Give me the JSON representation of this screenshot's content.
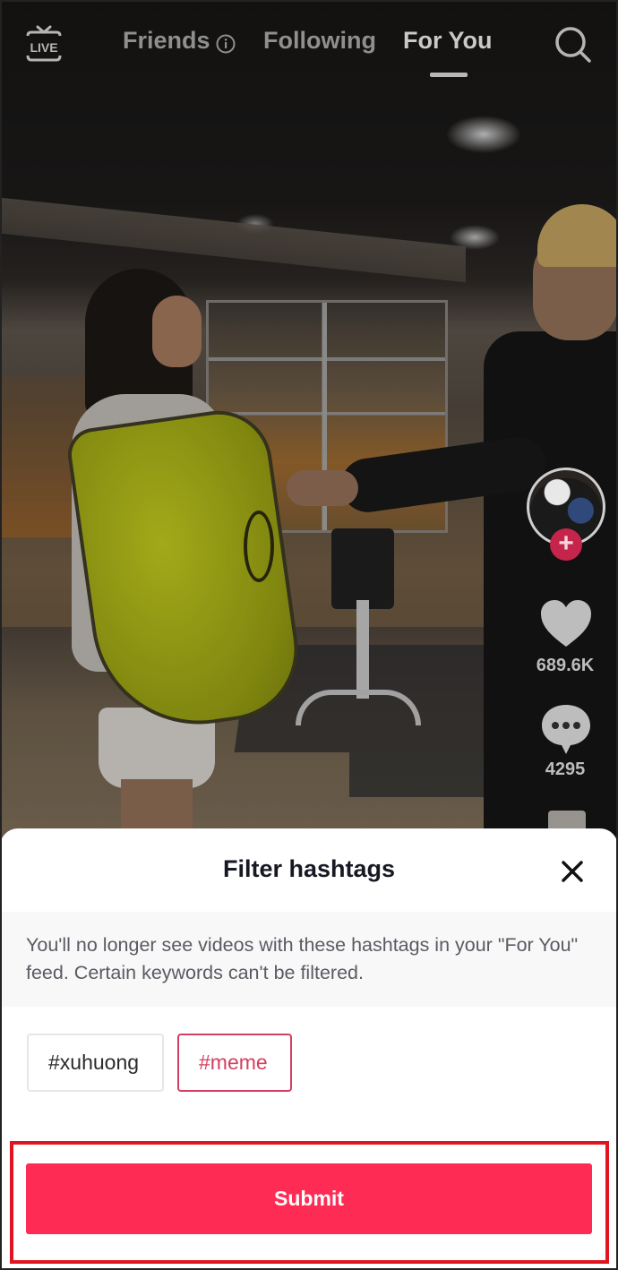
{
  "top_nav": {
    "live_label": "LIVE",
    "tabs": [
      {
        "label": "Friends",
        "has_info_icon": true,
        "active": false
      },
      {
        "label": "Following",
        "active": false
      },
      {
        "label": "For You",
        "active": true
      }
    ],
    "icons": {
      "live": "live-tv-icon",
      "info": "info-circle-icon",
      "search": "search-icon"
    }
  },
  "video_actions": {
    "avatar_icon": "creator-avatar",
    "follow_icon": "plus-icon",
    "follow_symbol": "+",
    "likes": "689.6K",
    "comments": "4295",
    "like_icon": "heart-icon",
    "comment_icon": "comment-bubble-icon"
  },
  "filter_sheet": {
    "title": "Filter hashtags",
    "close_icon": "close-icon",
    "description": "You'll no longer see videos with these hashtags in your \"For You\" feed. Certain keywords can't be filtered.",
    "hashtags": [
      {
        "label": "#xuhuong",
        "selected": false
      },
      {
        "label": "#meme",
        "selected": true
      }
    ],
    "submit_label": "Submit"
  },
  "colors": {
    "accent": "#fe2c55",
    "selected_chip": "#d43e5f",
    "highlight_annotation": "#e0151f",
    "title_text": "#161823",
    "notice_bg": "#f8f8f8"
  }
}
